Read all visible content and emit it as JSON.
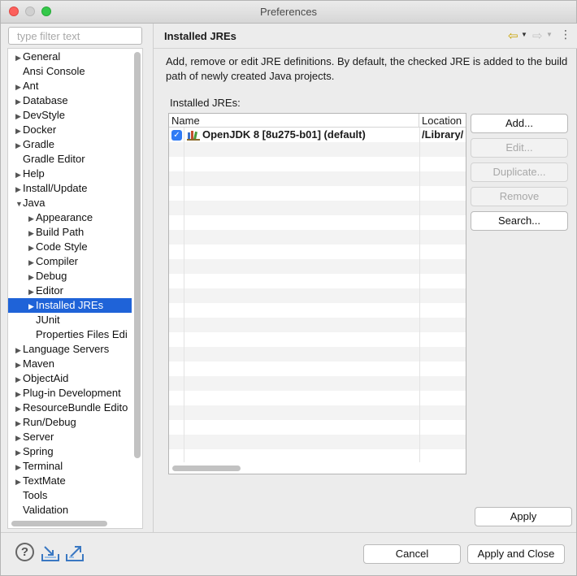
{
  "window": {
    "title": "Preferences"
  },
  "filter": {
    "placeholder": "type filter text"
  },
  "tree": [
    {
      "label": "General",
      "level": 0,
      "arrow": "right"
    },
    {
      "label": "Ansi Console",
      "level": 0,
      "arrow": "none"
    },
    {
      "label": "Ant",
      "level": 0,
      "arrow": "right"
    },
    {
      "label": "Database",
      "level": 0,
      "arrow": "right"
    },
    {
      "label": "DevStyle",
      "level": 0,
      "arrow": "right"
    },
    {
      "label": "Docker",
      "level": 0,
      "arrow": "right"
    },
    {
      "label": "Gradle",
      "level": 0,
      "arrow": "right"
    },
    {
      "label": "Gradle Editor",
      "level": 0,
      "arrow": "none"
    },
    {
      "label": "Help",
      "level": 0,
      "arrow": "right"
    },
    {
      "label": "Install/Update",
      "level": 0,
      "arrow": "right"
    },
    {
      "label": "Java",
      "level": 0,
      "arrow": "down"
    },
    {
      "label": "Appearance",
      "level": 1,
      "arrow": "right"
    },
    {
      "label": "Build Path",
      "level": 1,
      "arrow": "right"
    },
    {
      "label": "Code Style",
      "level": 1,
      "arrow": "right"
    },
    {
      "label": "Compiler",
      "level": 1,
      "arrow": "right"
    },
    {
      "label": "Debug",
      "level": 1,
      "arrow": "right"
    },
    {
      "label": "Editor",
      "level": 1,
      "arrow": "right"
    },
    {
      "label": "Installed JREs",
      "level": 1,
      "arrow": "right",
      "selected": true
    },
    {
      "label": "JUnit",
      "level": 1,
      "arrow": "none"
    },
    {
      "label": "Properties Files Edi",
      "level": 1,
      "arrow": "none"
    },
    {
      "label": "Language Servers",
      "level": 0,
      "arrow": "right"
    },
    {
      "label": "Maven",
      "level": 0,
      "arrow": "right"
    },
    {
      "label": "ObjectAid",
      "level": 0,
      "arrow": "right"
    },
    {
      "label": "Plug-in Development",
      "level": 0,
      "arrow": "right"
    },
    {
      "label": "ResourceBundle Edito",
      "level": 0,
      "arrow": "right"
    },
    {
      "label": "Run/Debug",
      "level": 0,
      "arrow": "right"
    },
    {
      "label": "Server",
      "level": 0,
      "arrow": "right"
    },
    {
      "label": "Spring",
      "level": 0,
      "arrow": "right"
    },
    {
      "label": "Terminal",
      "level": 0,
      "arrow": "right"
    },
    {
      "label": "TextMate",
      "level": 0,
      "arrow": "right"
    },
    {
      "label": "Tools",
      "level": 0,
      "arrow": "none"
    },
    {
      "label": "Validation",
      "level": 0,
      "arrow": "none"
    }
  ],
  "page": {
    "title": "Installed JREs",
    "description": "Add, remove or edit JRE definitions. By default, the checked JRE is added to the build path of newly created Java projects.",
    "list_label": "Installed JREs:",
    "columns": {
      "name": "Name",
      "location": "Location"
    },
    "jres": [
      {
        "name": "OpenJDK 8 [8u275-b01] (default)",
        "location": "/Library/",
        "checked": true
      }
    ]
  },
  "buttons": {
    "add": "Add...",
    "edit": "Edit...",
    "duplicate": "Duplicate...",
    "remove": "Remove",
    "search": "Search...",
    "apply": "Apply",
    "cancel": "Cancel",
    "apply_close": "Apply and Close"
  },
  "icons": {
    "back": "back-arrow-icon",
    "forward": "forward-arrow-icon",
    "menu": "view-menu-icon",
    "help": "help-icon",
    "import": "import-icon",
    "export": "export-icon",
    "jre": "jre-library-icon"
  },
  "colors": {
    "selection": "#1f63d8",
    "checkbox": "#2f7bf5",
    "back_arrow": "#c9a200"
  }
}
